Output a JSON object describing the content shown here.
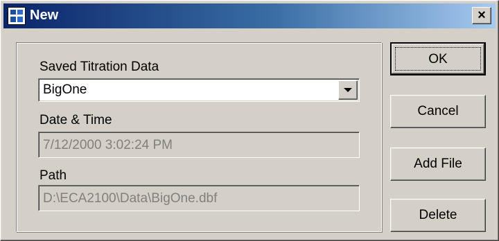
{
  "window": {
    "title": "New",
    "close_label": "×"
  },
  "form": {
    "saved_label": "Saved Titration Data",
    "saved_value": "BigOne",
    "date_label": "Date & Time",
    "date_value": "7/12/2000 3:02:24 PM",
    "path_label": "Path",
    "path_value": "D:\\ECA2100\\Data\\BigOne.dbf"
  },
  "buttons": {
    "ok": "OK",
    "cancel": "Cancel",
    "add_file": "Add File",
    "delete": "Delete"
  },
  "colors": {
    "title_start": "#0a246a",
    "title_end": "#a6caf0",
    "face": "#d4d0c8",
    "disabled_text": "#808080"
  },
  "icons": {
    "title": "application-icon",
    "combo": "chevron-down-icon"
  }
}
